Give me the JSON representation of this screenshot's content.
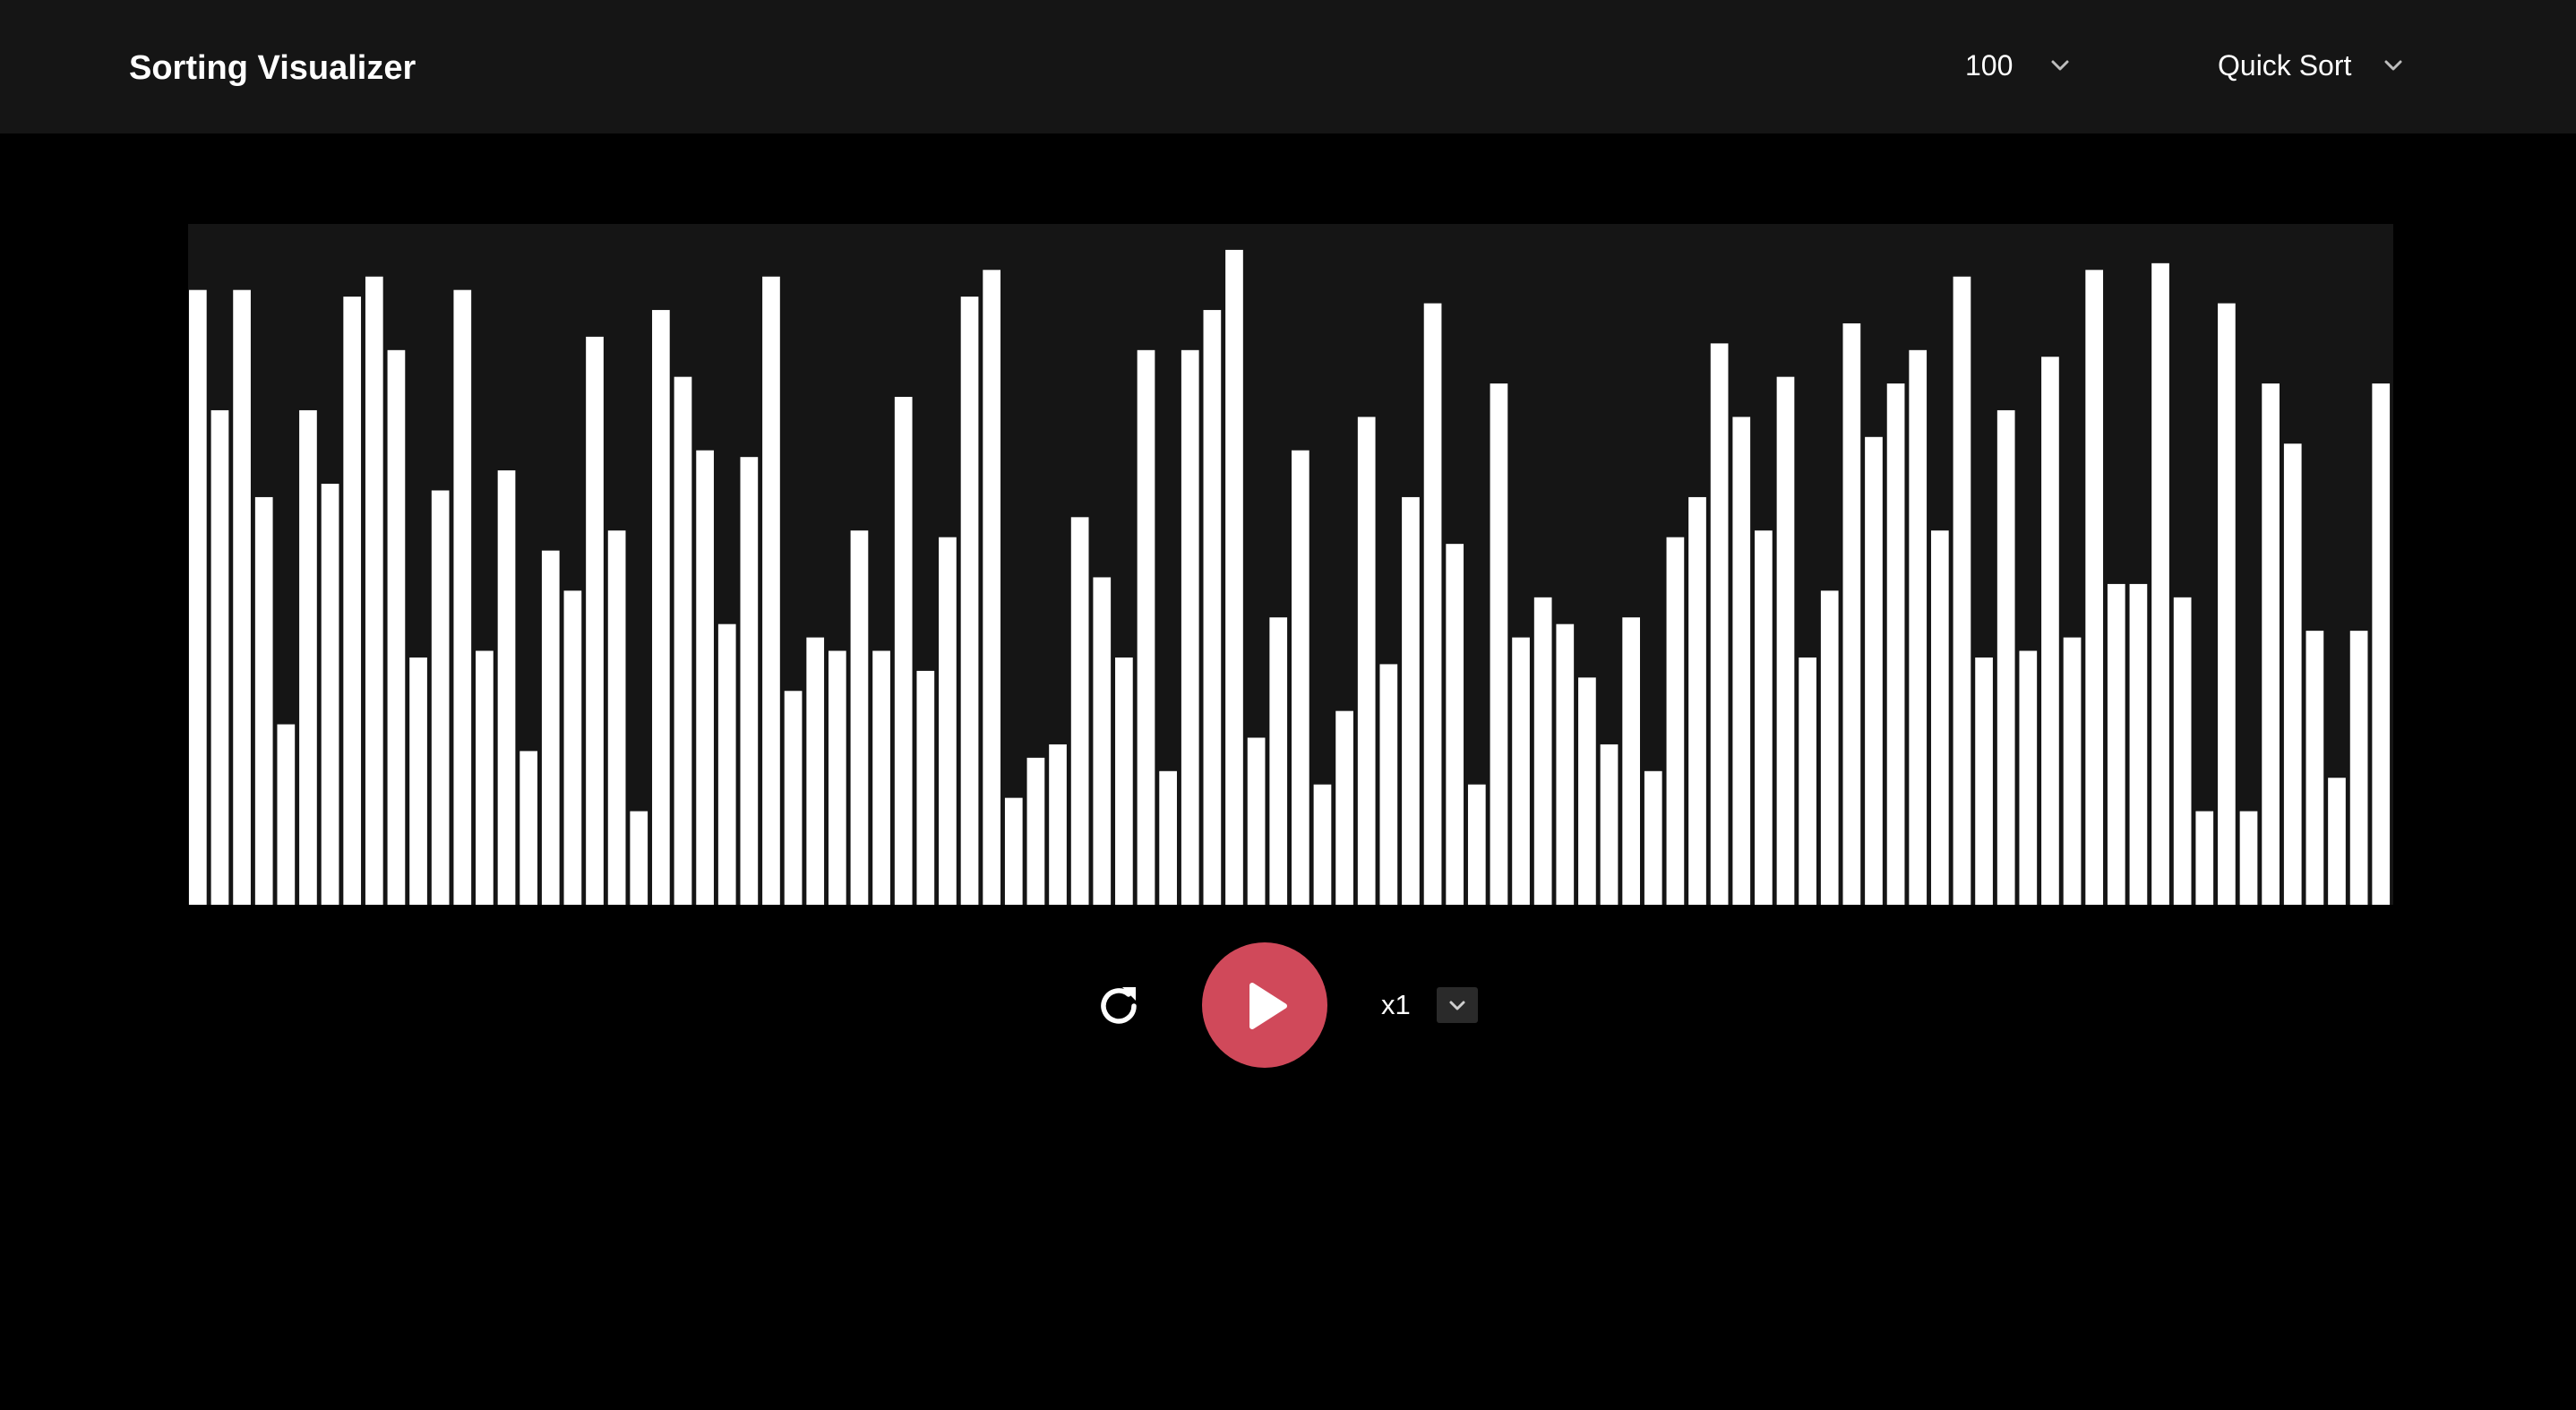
{
  "header": {
    "title": "Sorting Visualizer",
    "array_size": {
      "value": "100",
      "icon": "chevron-down-icon"
    },
    "algorithm": {
      "value": "Quick Sort",
      "icon": "chevron-down-icon"
    }
  },
  "colors": {
    "page_background": "#000000",
    "header_background": "#151515",
    "panel_background": "#151515",
    "bar": "#ffffff",
    "play_button": "#d0495a"
  },
  "chart_data": {
    "type": "bar",
    "xlabel": "",
    "ylabel": "",
    "ylim": [
      0,
      100
    ],
    "grid": false,
    "values": [
      92,
      74,
      92,
      61,
      27,
      74,
      63,
      91,
      94,
      83,
      37,
      62,
      92,
      38,
      65,
      23,
      53,
      47,
      85,
      56,
      14,
      89,
      79,
      68,
      42,
      67,
      94,
      32,
      40,
      38,
      56,
      38,
      76,
      35,
      55,
      91,
      95,
      16,
      22,
      24,
      58,
      49,
      37,
      83,
      20,
      83,
      89,
      98,
      25,
      43,
      68,
      18,
      29,
      73,
      36,
      61,
      90,
      54,
      18,
      78,
      40,
      46,
      42,
      34,
      24,
      43,
      20,
      55,
      61,
      84,
      73,
      56,
      79,
      37,
      47,
      87,
      70,
      78,
      83,
      56,
      94,
      37,
      74,
      38,
      82,
      40,
      95,
      48,
      48,
      96,
      46,
      14,
      90,
      14,
      78,
      69,
      41,
      19,
      41,
      78
    ],
    "bar_color": "#ffffff"
  },
  "controls": {
    "reset_icon": "refresh-icon",
    "play_icon": "play-icon",
    "speed_label": "x1",
    "speed_dropdown_icon": "chevron-down-icon"
  }
}
